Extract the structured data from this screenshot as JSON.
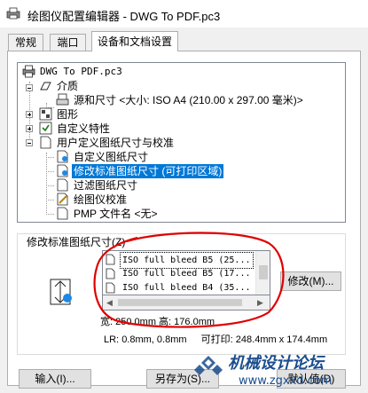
{
  "window": {
    "title": "绘图仪配置编辑器 - DWG To PDF.pc3"
  },
  "tabs": [
    {
      "label": "常规",
      "active": false
    },
    {
      "label": "端口",
      "active": false
    },
    {
      "label": "设备和文档设置",
      "active": true
    }
  ],
  "tree": {
    "items": [
      {
        "label": "DWG To PDF.pc3",
        "icon": "plotter-icon",
        "mono": true,
        "selected": false
      },
      {
        "label": "介质",
        "icon": "media-icon",
        "selected": false
      },
      {
        "label": "源和尺寸 <大小: ISO A4 (210.00 x 297.00 毫米)>",
        "icon": "paper-source-icon",
        "selected": false
      },
      {
        "label": "图形",
        "icon": "graphics-icon",
        "selected": false
      },
      {
        "label": "自定义特性",
        "icon": "custom-properties-icon",
        "selected": false
      },
      {
        "label": "用户定义图纸尺寸与校准",
        "icon": "user-defined-icon",
        "selected": false
      },
      {
        "label": "自定义图纸尺寸",
        "icon": "custom-paper-icon",
        "selected": false
      },
      {
        "label": "修改标准图纸尺寸 (可打印区域)",
        "icon": "modify-paper-icon",
        "selected": true
      },
      {
        "label": "过滤图纸尺寸",
        "icon": "filter-paper-icon",
        "selected": false
      },
      {
        "label": "绘图仪校准",
        "icon": "calibration-icon",
        "selected": false
      },
      {
        "label": "PMP 文件名 <无>",
        "icon": "pmp-file-icon",
        "selected": false
      }
    ]
  },
  "group": {
    "legend": "修改标准图纸尺寸(Z)",
    "list": [
      {
        "label": "ISO full bleed B5 (25..."
      },
      {
        "label": "ISO full bleed B5 (17..."
      },
      {
        "label": "ISO full bleed B4 (35..."
      }
    ],
    "modify_button": "修改(M)...",
    "width_label": "宽:",
    "width_value": "250.0mm",
    "height_label": "高:",
    "height_value": "176.0mm",
    "lr_label": "LR:",
    "lr_value": "0.8mm, 0.8mm",
    "printable_label": "可打印:",
    "printable_value": "248.4mm x 174.4mm"
  },
  "buttons": {
    "import": "输入(I)...",
    "save_as": "另存为(S)...",
    "defaults": "默认值(D)"
  },
  "watermark": {
    "text": "机械设计论坛",
    "url": "www.zgxxd.com"
  },
  "colors": {
    "selection": "#0078d7",
    "annotation": "#e00000",
    "window_bg": "#f0f0f0"
  }
}
